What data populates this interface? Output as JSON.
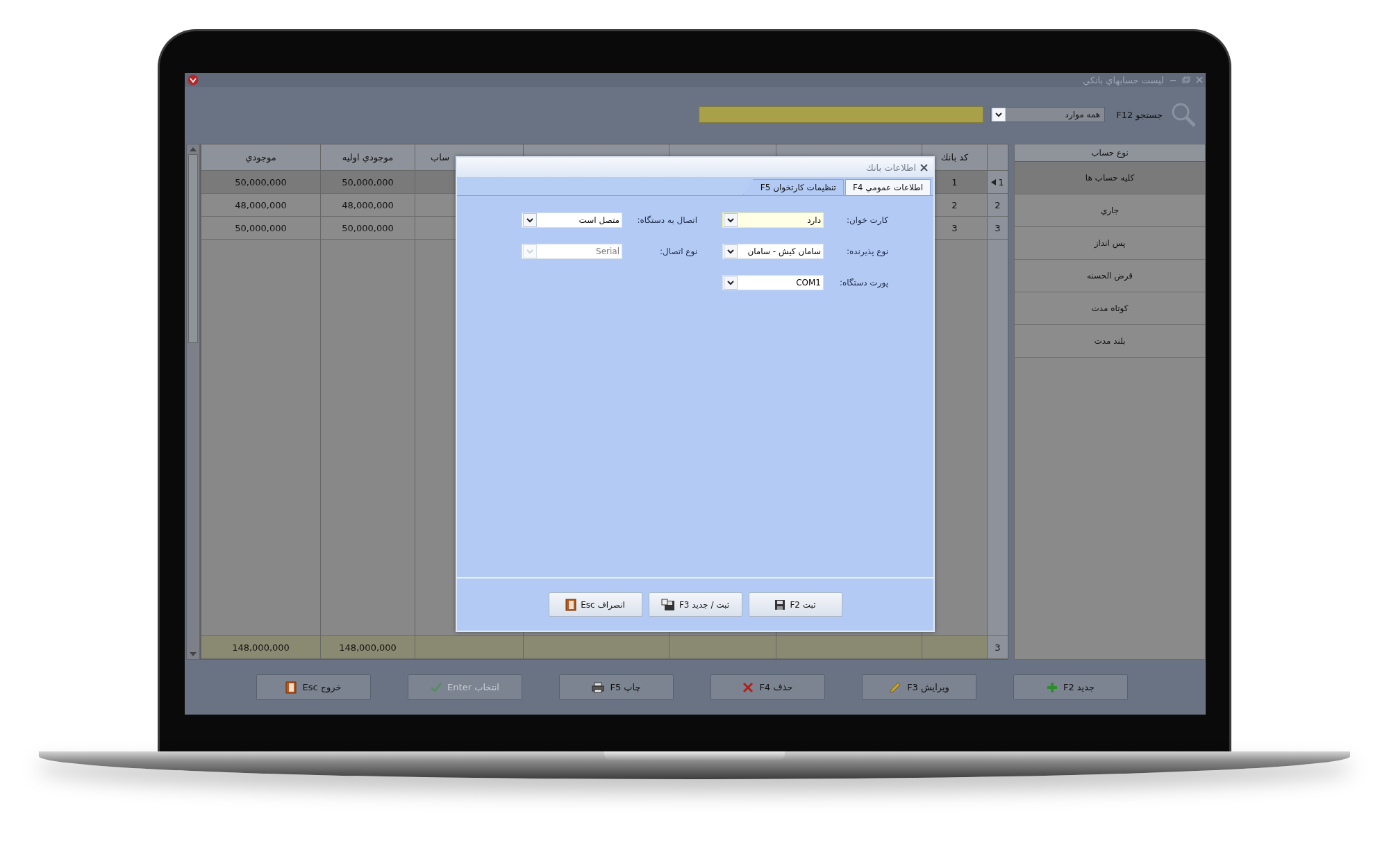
{
  "window": {
    "title": "ليست حسابهاي بانكي"
  },
  "search": {
    "label": "جستجو F12",
    "scope": "همه موارد"
  },
  "sidebar": {
    "header": "نوع حساب",
    "items": [
      {
        "label": "كليه حساب ها",
        "selected": true
      },
      {
        "label": "جاري",
        "selected": false
      },
      {
        "label": "پس انداز",
        "selected": false
      },
      {
        "label": "قرض الحسنه",
        "selected": false
      },
      {
        "label": "كوتاه مدت",
        "selected": false
      },
      {
        "label": "بلند مدت",
        "selected": false
      }
    ]
  },
  "table": {
    "columns": [
      "كد بانك",
      null,
      null,
      null,
      "ساب",
      "موجودي اوليه",
      "موجودي"
    ],
    "rows": [
      {
        "number": "1",
        "selected": true,
        "cells": [
          "1",
          null,
          null,
          null,
          null,
          "50,000,000",
          "50,000,000"
        ]
      },
      {
        "number": "2",
        "selected": false,
        "cells": [
          "2",
          null,
          null,
          null,
          null,
          "48,000,000",
          "48,000,000"
        ]
      },
      {
        "number": "3",
        "selected": false,
        "cells": [
          "3",
          null,
          null,
          null,
          null,
          "50,000,000",
          "50,000,000"
        ]
      }
    ],
    "footer": {
      "number": "3",
      "cells": [
        null,
        null,
        null,
        null,
        null,
        "148,000,000",
        "148,000,000"
      ]
    }
  },
  "toolbar_buttons": [
    {
      "label": "جديد F2",
      "disabled": false
    },
    {
      "label": "ويرايش F3",
      "disabled": false
    },
    {
      "label": "حذف F4",
      "disabled": false
    },
    {
      "label": "چاپ F5",
      "disabled": false
    },
    {
      "label": "انتخاب Enter",
      "disabled": true
    },
    {
      "label": "خروج Esc",
      "disabled": false
    }
  ],
  "dialog": {
    "title": "اطلاعات بانك",
    "tabs": [
      {
        "label": "اطلاعات عمومي F4",
        "selected": false
      },
      {
        "label": "تنظيمات كارتخوان F5",
        "selected": true
      }
    ],
    "fields": [
      {
        "label": "كارت خوان:",
        "value": "دارد",
        "focused": true,
        "disabled": false
      },
      {
        "label": "اتصال به دستگاه:",
        "value": "متصل است",
        "focused": false,
        "disabled": false
      },
      {
        "label": "نوع پذيرنده:",
        "value": "سامان كيش - سامان",
        "focused": false,
        "disabled": false
      },
      {
        "label": "نوع اتصال:",
        "value": "Serial",
        "focused": false,
        "disabled": true
      },
      {
        "label": "پورت دستگاه:",
        "value": "COM1",
        "focused": false,
        "disabled": false
      }
    ],
    "buttons": [
      {
        "label": "ثبت F2"
      },
      {
        "label": "ثبت / جديد F3"
      },
      {
        "label": "انصراف Esc"
      }
    ]
  }
}
